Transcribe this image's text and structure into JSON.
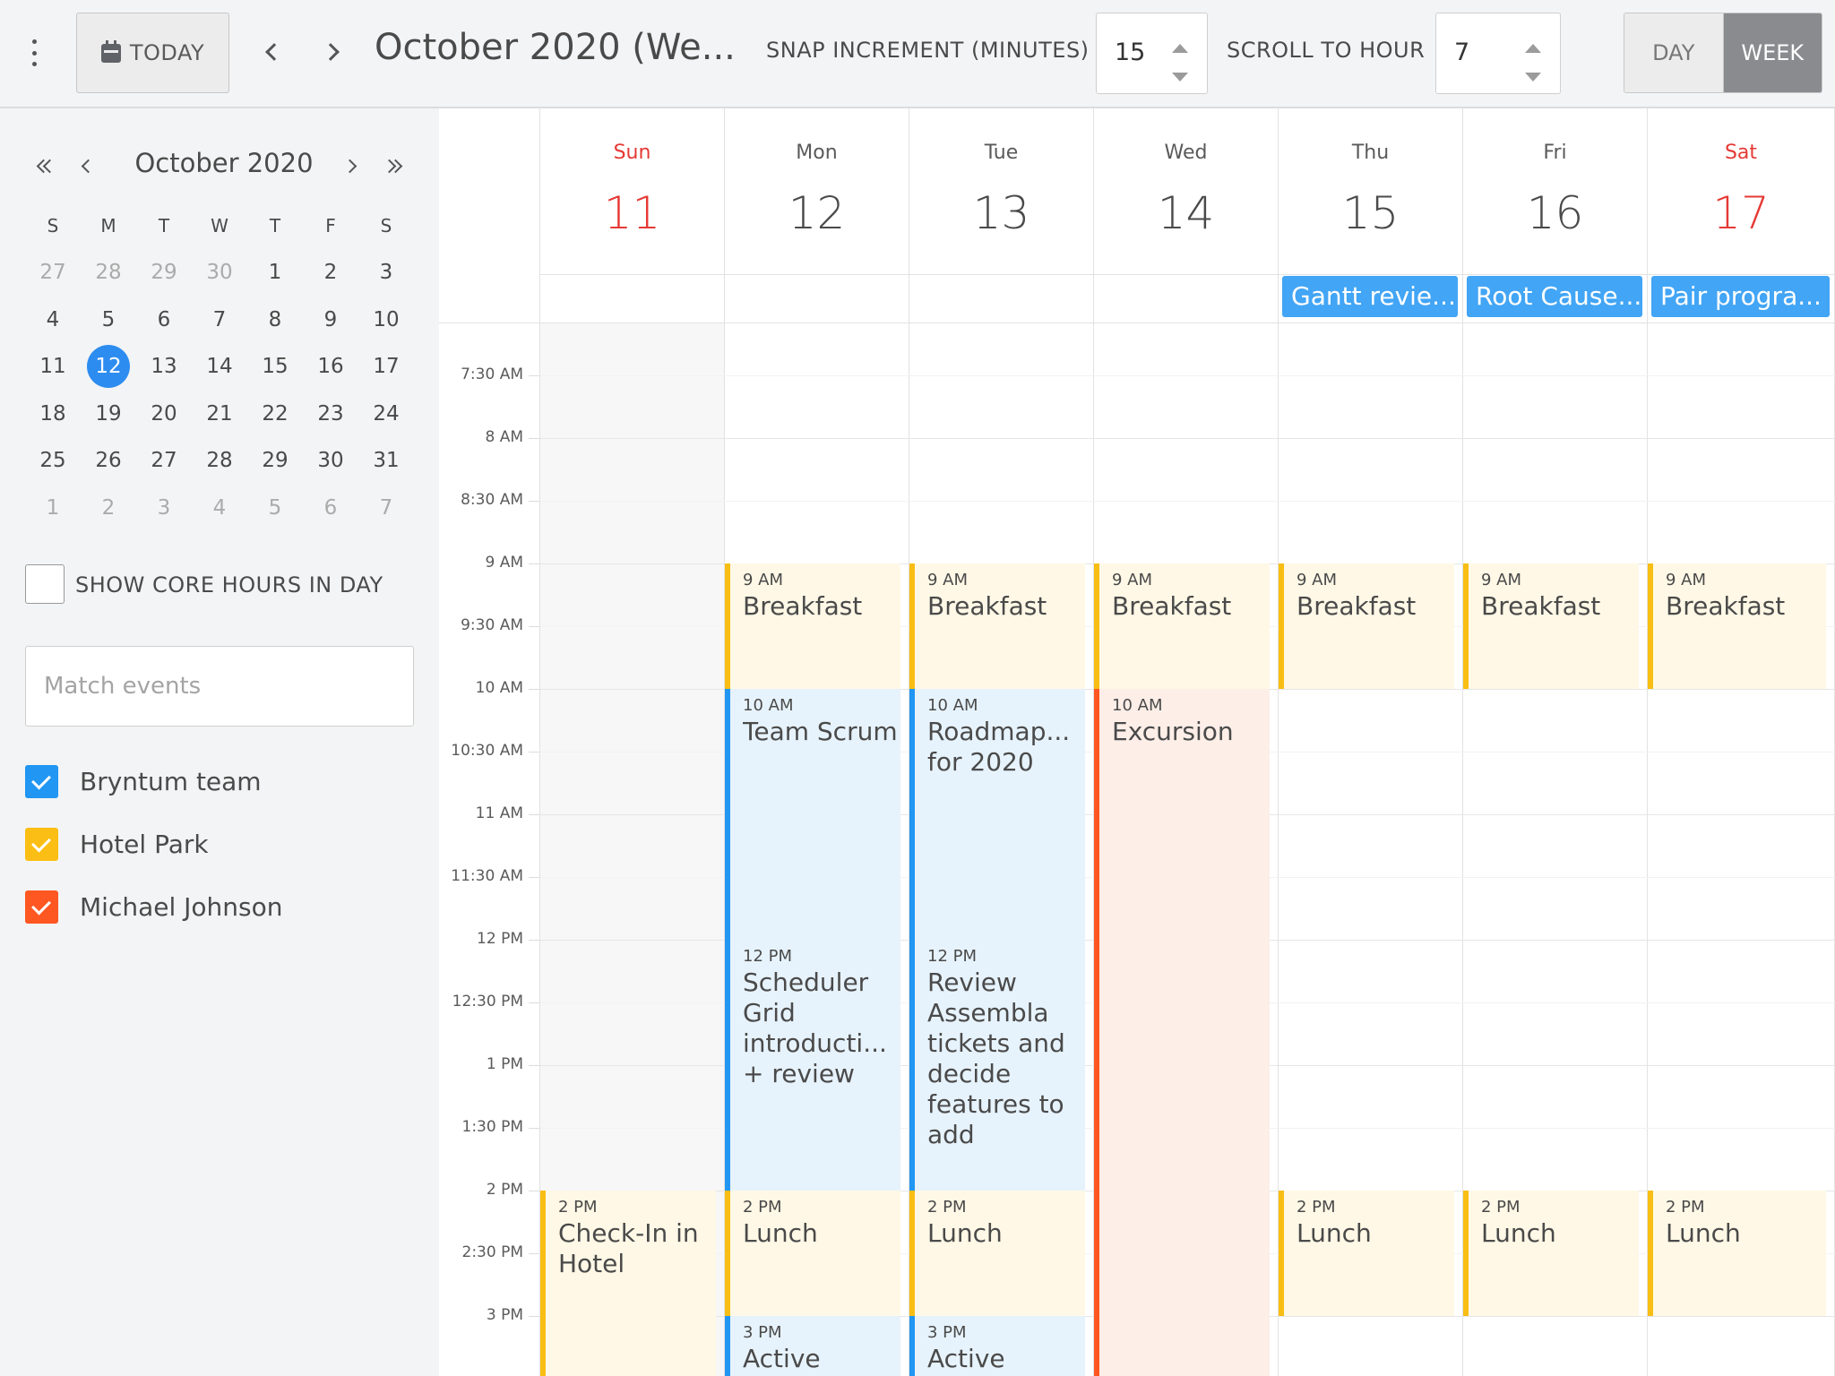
{
  "toolbar": {
    "today_label": "TODAY",
    "title": "October 2020 (We...",
    "snap_label": "SNAP INCREMENT (MINUTES)",
    "snap_value": "15",
    "scroll_label": "SCROLL TO HOUR",
    "scroll_value": "7",
    "view_day": "DAY",
    "view_week": "WEEK",
    "active_view": "WEEK"
  },
  "minical": {
    "title": "October 2020",
    "weekdays": [
      "S",
      "M",
      "T",
      "W",
      "T",
      "F",
      "S"
    ],
    "weeks": [
      [
        "27",
        "28",
        "29",
        "30",
        "1",
        "2",
        "3"
      ],
      [
        "4",
        "5",
        "6",
        "7",
        "8",
        "9",
        "10"
      ],
      [
        "11",
        "12",
        "13",
        "14",
        "15",
        "16",
        "17"
      ],
      [
        "18",
        "19",
        "20",
        "21",
        "22",
        "23",
        "24"
      ],
      [
        "25",
        "26",
        "27",
        "28",
        "29",
        "30",
        "31"
      ],
      [
        "1",
        "2",
        "3",
        "4",
        "5",
        "6",
        "7"
      ]
    ],
    "selected": "12"
  },
  "sidebar": {
    "core_hours_label": "SHOW CORE HOURS IN DAY",
    "core_hours_checked": false,
    "match_placeholder": "Match events",
    "resources": [
      {
        "name": "Bryntum team",
        "color": "#2196f3",
        "checked": true
      },
      {
        "name": "Hotel Park",
        "color": "#fbbe14",
        "checked": true
      },
      {
        "name": "Michael Johnson",
        "color": "#ff5722",
        "checked": true
      }
    ]
  },
  "week": {
    "days": [
      {
        "name": "Sun",
        "num": "11",
        "weekend": true
      },
      {
        "name": "Mon",
        "num": "12",
        "weekend": false
      },
      {
        "name": "Tue",
        "num": "13",
        "weekend": false
      },
      {
        "name": "Wed",
        "num": "14",
        "weekend": false
      },
      {
        "name": "Thu",
        "num": "15",
        "weekend": false
      },
      {
        "name": "Fri",
        "num": "16",
        "weekend": false
      },
      {
        "name": "Sat",
        "num": "17",
        "weekend": true
      }
    ],
    "all_day_events": [
      {
        "day": 4,
        "name": "Gantt revie..."
      },
      {
        "day": 5,
        "name": "Root Cause..."
      },
      {
        "day": 6,
        "name": "Pair progra..."
      }
    ],
    "time_labels": [
      "7:30 AM",
      "8 AM",
      "8:30 AM",
      "9 AM",
      "9:30 AM",
      "10 AM",
      "10:30 AM",
      "11 AM",
      "11:30 AM",
      "12 PM",
      "12:30 PM",
      "1 PM",
      "1:30 PM",
      "2 PM",
      "2:30 PM",
      "3 PM"
    ],
    "events": [
      {
        "day": 1,
        "start": 9,
        "end": 10,
        "time": "9 AM",
        "name": "Breakfast",
        "color": "yellow"
      },
      {
        "day": 2,
        "start": 9,
        "end": 10,
        "time": "9 AM",
        "name": "Breakfast",
        "color": "yellow"
      },
      {
        "day": 3,
        "start": 9,
        "end": 10,
        "time": "9 AM",
        "name": "Breakfast",
        "color": "yellow"
      },
      {
        "day": 4,
        "start": 9,
        "end": 10,
        "time": "9 AM",
        "name": "Breakfast",
        "color": "yellow"
      },
      {
        "day": 5,
        "start": 9,
        "end": 10,
        "time": "9 AM",
        "name": "Breakfast",
        "color": "yellow"
      },
      {
        "day": 6,
        "start": 9,
        "end": 10,
        "time": "9 AM",
        "name": "Breakfast",
        "color": "yellow"
      },
      {
        "day": 1,
        "start": 10,
        "end": 12,
        "time": "10 AM",
        "name": "Team Scrum",
        "color": "blue"
      },
      {
        "day": 2,
        "start": 10,
        "end": 12,
        "time": "10 AM",
        "name": "Roadmap... for 2020",
        "color": "blue"
      },
      {
        "day": 3,
        "start": 10,
        "end": 16,
        "time": "10 AM",
        "name": "Excursion",
        "color": "orange"
      },
      {
        "day": 1,
        "start": 12,
        "end": 14,
        "time": "12 PM",
        "name": "Scheduler Grid introducti... + review",
        "color": "blue"
      },
      {
        "day": 2,
        "start": 12,
        "end": 14,
        "time": "12 PM",
        "name": "Review Assembla tickets and decide features to add",
        "color": "blue"
      },
      {
        "day": 0,
        "start": 14,
        "end": 16,
        "time": "2 PM",
        "name": "Check-In in Hotel",
        "color": "yellow"
      },
      {
        "day": 1,
        "start": 14,
        "end": 15,
        "time": "2 PM",
        "name": "Lunch",
        "color": "yellow"
      },
      {
        "day": 2,
        "start": 14,
        "end": 15,
        "time": "2 PM",
        "name": "Lunch",
        "color": "yellow"
      },
      {
        "day": 4,
        "start": 14,
        "end": 15,
        "time": "2 PM",
        "name": "Lunch",
        "color": "yellow"
      },
      {
        "day": 5,
        "start": 14,
        "end": 15,
        "time": "2 PM",
        "name": "Lunch",
        "color": "yellow"
      },
      {
        "day": 6,
        "start": 14,
        "end": 15,
        "time": "2 PM",
        "name": "Lunch",
        "color": "yellow"
      },
      {
        "day": 1,
        "start": 15,
        "end": 16,
        "time": "3 PM",
        "name": "Active",
        "color": "blue"
      },
      {
        "day": 2,
        "start": 15,
        "end": 16,
        "time": "3 PM",
        "name": "Active",
        "color": "blue"
      }
    ]
  }
}
